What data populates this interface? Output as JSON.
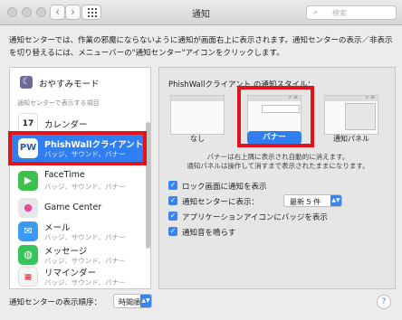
{
  "window": {
    "title": "通知"
  },
  "toolbar": {
    "back": "‹",
    "forward": "›",
    "search_placeholder": "検索",
    "search_icon": "⌕"
  },
  "intro_text": "通知センターでは、作業の邪魔にならないように通知が画面右上に表示されます。通知センターの表示／非表示を切り替えるには、メニューバーの\"通知センター\"アイコンをクリックします。",
  "sidebar": {
    "dnd_label": "おやすみモード",
    "dnd_icon": "☾",
    "section_label": "通知センターで表示する項目",
    "apps": [
      {
        "name": "カレンダー",
        "sub": "",
        "icon_text": "17",
        "color": "#ffffff"
      },
      {
        "name": "PhishWallクライアント",
        "sub": "バッジ、サウンド、バナー",
        "icon_text": "PW",
        "color": "#2a5db0"
      },
      {
        "name": "FaceTime",
        "sub": "バッジ、サウンド、バナー",
        "icon_text": "▶",
        "color": "#3cc24a"
      },
      {
        "name": "Game Center",
        "sub": "バッジ、サウンド、バナー",
        "icon_text": "●",
        "color": "#e7e7e7"
      },
      {
        "name": "メール",
        "sub": "バッジ、サウンド、バナー",
        "icon_text": "✉",
        "color": "#3c9af0"
      },
      {
        "name": "メッセージ",
        "sub": "バッジ、サウンド、バナー",
        "icon_text": "◍",
        "color": "#35c55a"
      },
      {
        "name": "リマインダー",
        "sub": "バッジ、サウンド、バナー",
        "icon_text": "≡",
        "color": "#f4f4f4"
      }
    ]
  },
  "style_panel": {
    "title": "PhishWallクライアント の通知スタイル：",
    "options": [
      {
        "label": "なし"
      },
      {
        "label": "バナー"
      },
      {
        "label": "通知パネル"
      }
    ],
    "note_line1": "バナーは右上隅に表示され自動的に消えます。",
    "note_line2": "通知パネルは操作して消すまで表示されたままになります。",
    "checkboxes": [
      {
        "label": "ロック画面に通知を表示",
        "checked": true
      },
      {
        "label": "通知センターに表示：",
        "checked": true
      },
      {
        "label": "アプリケーションアイコンにバッジを表示",
        "checked": true
      },
      {
        "label": "通知音を鳴らす",
        "checked": true
      }
    ],
    "recent_select": "最新 5 件",
    "check_mark": "✓"
  },
  "footer": {
    "sort_label": "通知センターの表示順序：",
    "sort_value": "時間順",
    "help": "?"
  },
  "colors": {
    "highlight": "#2f7ff3",
    "annotation_red": "#e0141a"
  }
}
